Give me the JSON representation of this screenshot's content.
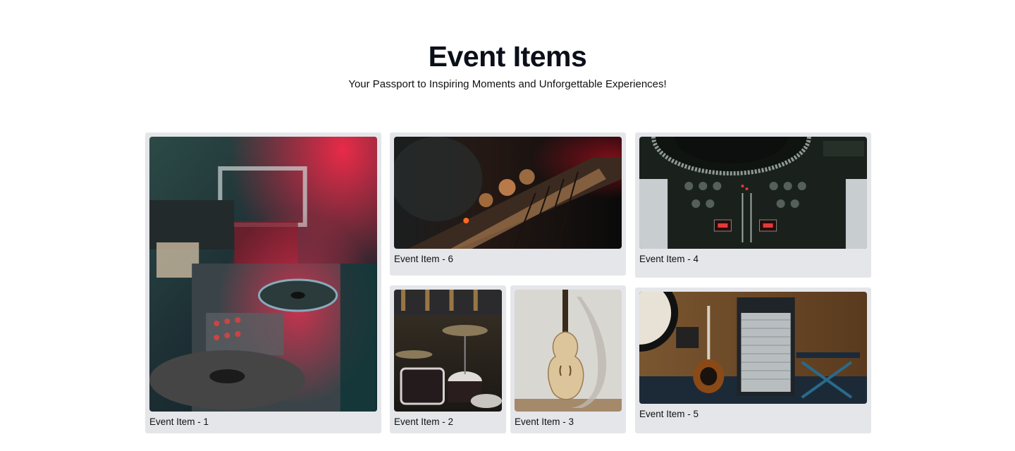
{
  "header": {
    "title": "Event Items",
    "subtitle": "Your Passport to Inspiring Moments and Unforgettable Experiences!"
  },
  "items": [
    {
      "label": "Event Item - 1",
      "image": "dj-turntable-mixer-photo"
    },
    {
      "label": "Event Item - 6",
      "image": "amplifier-knobs-photo"
    },
    {
      "label": "Event Item - 4",
      "image": "dj-deck-mixer-photo"
    },
    {
      "label": "Event Item - 2",
      "image": "drum-kit-photo"
    },
    {
      "label": "Event Item - 3",
      "image": "violin-photo"
    },
    {
      "label": "Event Item - 5",
      "image": "guitar-amplifier-photo"
    }
  ],
  "colors": {
    "card_background": "#e5e6ea",
    "title": "#0b0f19",
    "page_background": "#ffffff"
  }
}
